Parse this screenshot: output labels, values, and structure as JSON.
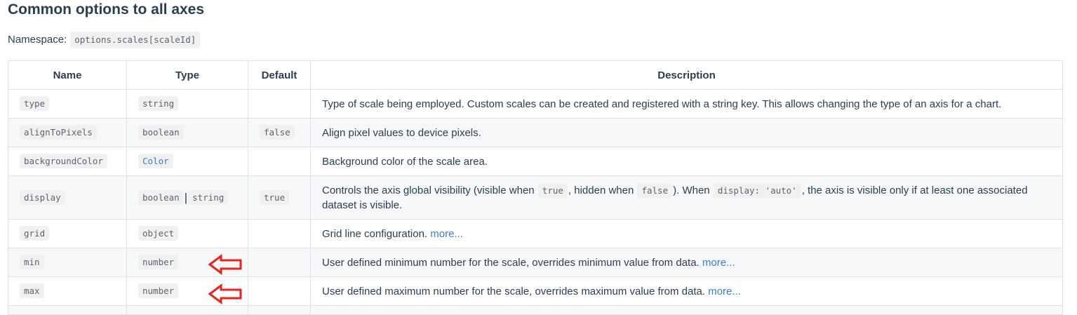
{
  "heading": "Common options to all axes",
  "namespace": {
    "label": "Namespace:",
    "value": "options.scales[scaleId]"
  },
  "table": {
    "headers": {
      "name": "Name",
      "type": "Type",
      "default": "Default",
      "description": "Description"
    },
    "rows": [
      {
        "name": "type",
        "type": "string",
        "default": "",
        "description": "Type of scale being employed. Custom scales can be created and registered with a string key. This allows changing the type of an axis for a chart."
      },
      {
        "name": "alignToPixels",
        "type": "boolean",
        "default": "false",
        "description": "Align pixel values to device pixels."
      },
      {
        "name": "backgroundColor",
        "type": "Color",
        "default": "",
        "description": "Background color of the scale area."
      },
      {
        "name": "display",
        "type": "boolean",
        "type2": "string",
        "default": "true",
        "desc_parts": [
          "Controls the axis global visibility (visible when ",
          "true",
          ", hidden when ",
          "false",
          "). When ",
          "display: 'auto'",
          ", the axis is visible only if at least one associated dataset is visible."
        ]
      },
      {
        "name": "grid",
        "type": "object",
        "default": "",
        "description": "Grid line configuration.",
        "link": "more..."
      },
      {
        "name": "min",
        "type": "number",
        "default": "",
        "description": "User defined minimum number for the scale, overrides minimum value from data.",
        "link": "more..."
      },
      {
        "name": "max",
        "type": "number",
        "default": "",
        "description": "User defined maximum number for the scale, overrides maximum value from data.",
        "link": "more..."
      }
    ]
  },
  "annotations": {
    "arrow_color": "#e8231c",
    "arrow_icon": "red-left-arrow-icon"
  }
}
